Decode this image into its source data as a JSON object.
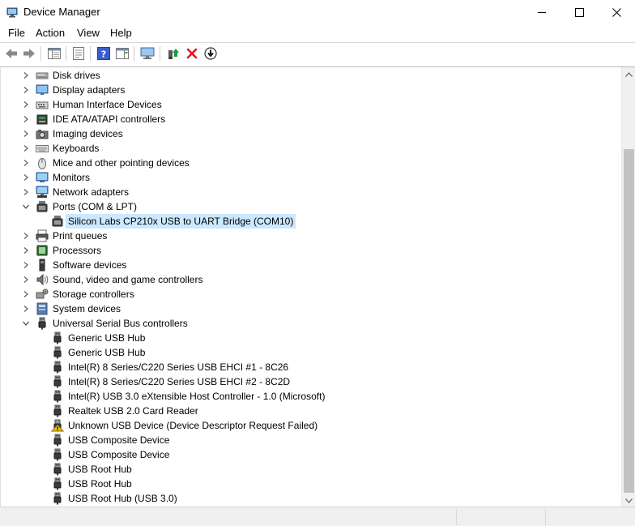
{
  "window": {
    "title": "Device Manager",
    "controls": {
      "minimize": "─",
      "maximize": "☐",
      "close": "✕"
    }
  },
  "menu": [
    "File",
    "Action",
    "View",
    "Help"
  ],
  "toolbar": [
    "back-icon",
    "forward-icon",
    "properties-icon",
    "details-icon",
    "help-icon",
    "view-icon",
    "monitor-icon",
    "update-driver-icon",
    "uninstall-icon",
    "disable-icon"
  ],
  "tree": [
    {
      "label": "Disk drives",
      "icon": "disk-drive",
      "expanded": false,
      "level": 0
    },
    {
      "label": "Display adapters",
      "icon": "display",
      "expanded": false,
      "level": 0
    },
    {
      "label": "Human Interface Devices",
      "icon": "hid",
      "expanded": false,
      "level": 0
    },
    {
      "label": "IDE ATA/ATAPI controllers",
      "icon": "ide",
      "expanded": false,
      "level": 0
    },
    {
      "label": "Imaging devices",
      "icon": "camera",
      "expanded": false,
      "level": 0
    },
    {
      "label": "Keyboards",
      "icon": "keyboard",
      "expanded": false,
      "level": 0
    },
    {
      "label": "Mice and other pointing devices",
      "icon": "mouse",
      "expanded": false,
      "level": 0
    },
    {
      "label": "Monitors",
      "icon": "monitor",
      "expanded": false,
      "level": 0
    },
    {
      "label": "Network adapters",
      "icon": "network",
      "expanded": false,
      "level": 0
    },
    {
      "label": "Ports (COM & LPT)",
      "icon": "port",
      "expanded": true,
      "level": 0
    },
    {
      "label": "Silicon Labs CP210x USB to UART Bridge (COM10)",
      "icon": "port",
      "level": 1,
      "selected": true
    },
    {
      "label": "Print queues",
      "icon": "printer",
      "expanded": false,
      "level": 0
    },
    {
      "label": "Processors",
      "icon": "cpu",
      "expanded": false,
      "level": 0
    },
    {
      "label": "Software devices",
      "icon": "software",
      "expanded": false,
      "level": 0
    },
    {
      "label": "Sound, video and game controllers",
      "icon": "sound",
      "expanded": false,
      "level": 0
    },
    {
      "label": "Storage controllers",
      "icon": "storage",
      "expanded": false,
      "level": 0
    },
    {
      "label": "System devices",
      "icon": "system",
      "expanded": false,
      "level": 0
    },
    {
      "label": "Universal Serial Bus controllers",
      "icon": "usb",
      "expanded": true,
      "level": 0
    },
    {
      "label": "Generic USB Hub",
      "icon": "usb",
      "level": 1
    },
    {
      "label": "Generic USB Hub",
      "icon": "usb",
      "level": 1
    },
    {
      "label": "Intel(R) 8 Series/C220 Series USB EHCI #1 - 8C26",
      "icon": "usb",
      "level": 1
    },
    {
      "label": "Intel(R) 8 Series/C220 Series USB EHCI #2 - 8C2D",
      "icon": "usb",
      "level": 1
    },
    {
      "label": "Intel(R) USB 3.0 eXtensible Host Controller - 1.0 (Microsoft)",
      "icon": "usb",
      "level": 1
    },
    {
      "label": "Realtek USB 2.0 Card Reader",
      "icon": "usb",
      "level": 1
    },
    {
      "label": "Unknown USB Device (Device Descriptor Request Failed)",
      "icon": "usb-warning",
      "level": 1
    },
    {
      "label": "USB Composite Device",
      "icon": "usb",
      "level": 1
    },
    {
      "label": "USB Composite Device",
      "icon": "usb",
      "level": 1
    },
    {
      "label": "USB Root Hub",
      "icon": "usb",
      "level": 1
    },
    {
      "label": "USB Root Hub",
      "icon": "usb",
      "level": 1
    },
    {
      "label": "USB Root Hub (USB 3.0)",
      "icon": "usb",
      "level": 1
    }
  ],
  "colors": {
    "selection": "#cce8ff",
    "uninstall": "#e81123",
    "update": "#1f9a3a",
    "warning": "#f2c200"
  }
}
